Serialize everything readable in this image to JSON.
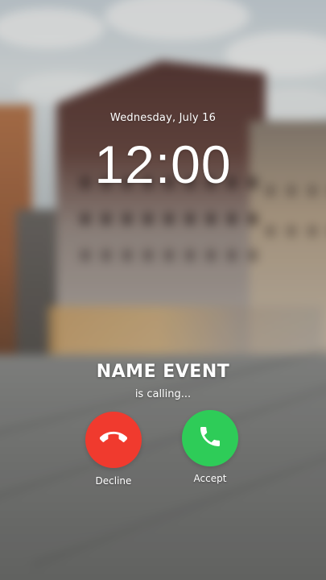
{
  "lock_screen": {
    "date": "Wednesday, July 16",
    "time": "12:00"
  },
  "incoming_call": {
    "caller_name": "NAME EVENT",
    "status": "is calling...",
    "decline": {
      "label": "Decline",
      "color": "#f03a2e",
      "icon": "phone-hangup-icon"
    },
    "accept": {
      "label": "Accept",
      "color": "#2ecc58",
      "icon": "phone-icon"
    }
  },
  "wallpaper": {
    "description_icon": "blurred-city-background"
  }
}
